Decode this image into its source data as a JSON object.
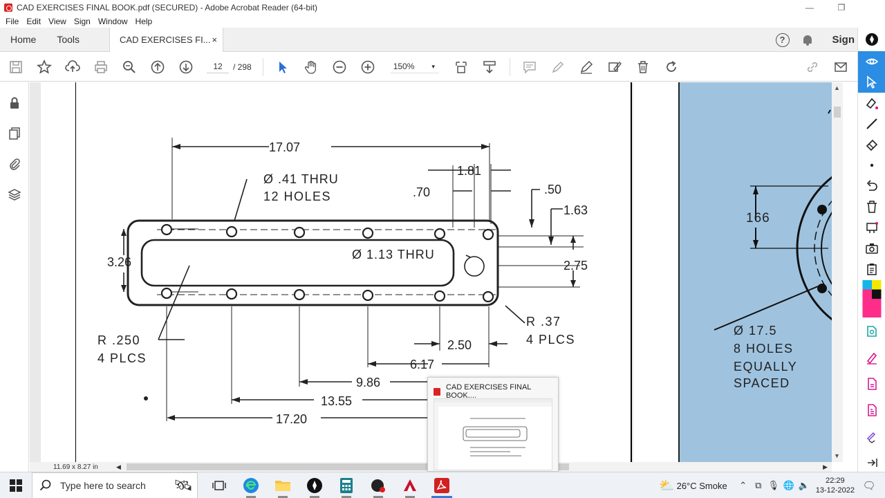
{
  "window": {
    "title": "CAD EXERCISES FINAL BOOK.pdf (SECURED) - Adobe Acrobat Reader (64-bit)",
    "minimize": "—",
    "restore": "❐"
  },
  "menu": [
    "File",
    "Edit",
    "View",
    "Sign",
    "Window",
    "Help"
  ],
  "tabs": {
    "home": "Home",
    "tools": "Tools",
    "document": "CAD EXERCISES FI...",
    "close": "×",
    "help": "?",
    "sign_in": "Sign"
  },
  "toolbar": {
    "page_current": "12",
    "page_total": "/ 298",
    "zoom": "150%"
  },
  "status": {
    "page_size": "11.69 x 8.27 in"
  },
  "drawing": {
    "dim_17_07": "17.07",
    "hole_note_1": "Ø .41 THRU",
    "hole_note_2": "12 HOLES",
    "dim_1_81": "1.81",
    "dim_70": ".70",
    "dim_50": ".50",
    "dim_1_63": "1.63",
    "dim_3_26": "3.26",
    "big_hole": "Ø 1.13 THRU",
    "dim_2_75": "2.75",
    "radius_inner_1": "R .250",
    "radius_inner_2": "4 PLCS",
    "radius_outer_1": "R .37",
    "radius_outer_2": "4 PLCS",
    "dim_2_50": "2.50",
    "dim_6_17": "6.17",
    "dim_9_86": "9.86",
    "dim_13_55": "13.55",
    "dim_17_20": "17.20"
  },
  "drawing2": {
    "dim_166": "166",
    "note_1": "Ø 17.5",
    "note_2": "8 HOLES",
    "note_3": "EQUALLY",
    "note_4": "SPACED"
  },
  "popup": {
    "title": "CAD EXERCISES FINAL BOOK...."
  },
  "taskbar": {
    "search_placeholder": "Type here to search",
    "weather": "26°C  Smoke",
    "time": "22:29",
    "date": "13-12-2022"
  },
  "colors": {
    "acrobat_red": "#d22020",
    "active_blue": "#2b8de3",
    "page2_bg": "#9fc3df"
  }
}
